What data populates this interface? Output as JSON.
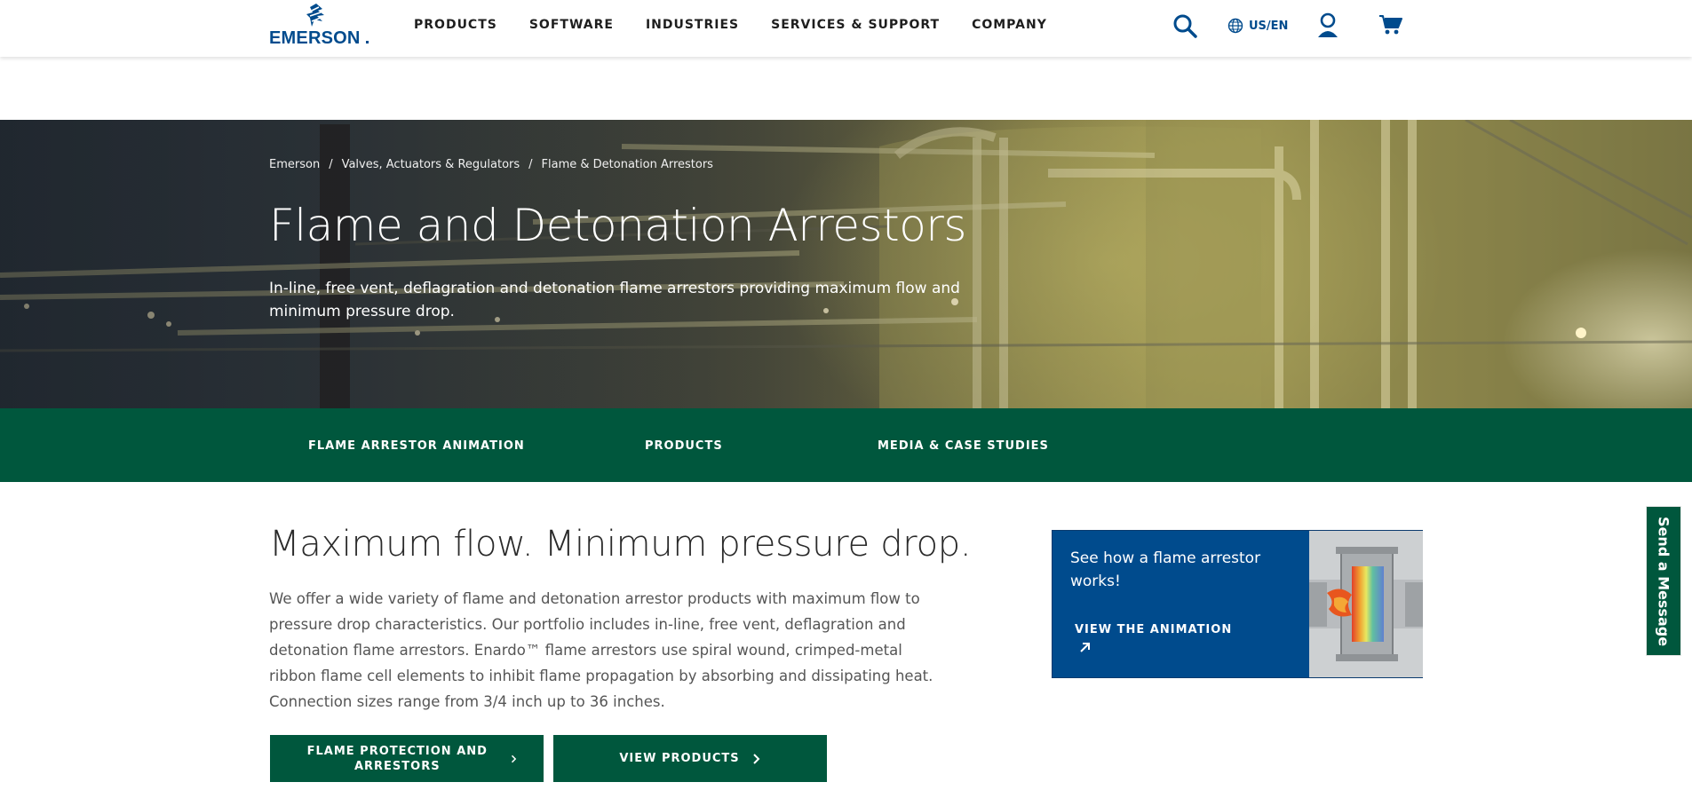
{
  "header": {
    "logo_text": "EMERSON",
    "nav": [
      "PRODUCTS",
      "SOFTWARE",
      "INDUSTRIES",
      "SERVICES & SUPPORT",
      "COMPANY"
    ],
    "locale": "US/EN",
    "icons": [
      "search-icon",
      "globe-icon",
      "user-icon",
      "cart-icon"
    ],
    "accent_color": "#004b8d"
  },
  "hero": {
    "breadcrumb": [
      "Emerson",
      "Valves, Actuators & Regulators",
      "Flame & Detonation Arrestors"
    ],
    "title": "Flame and Detonation Arrestors",
    "subtitle": "In-line, free vent, deflagration and detonation flame arrestors providing maximum flow and minimum pressure drop."
  },
  "subnav": {
    "items": [
      "FLAME ARRESTOR ANIMATION",
      "PRODUCTS",
      "MEDIA & CASE STUDIES"
    ],
    "color": "#00573d"
  },
  "main": {
    "title": "Maximum flow. Minimum pressure drop.",
    "body": "We offer a wide variety of flame and detonation arrestor products with maximum flow to pressure drop characteristics. Our portfolio includes in-line, free vent, deflagration and detonation flame arrestors. Enardo™ flame arrestors use spiral wound, crimped-metal ribbon flame cell elements to inhibit flame propagation by absorbing and dissipating heat. Connection sizes range from 3/4 inch up to 36 inches.",
    "buttons": {
      "flame_protection": "FLAME PROTECTION AND ARRESTORS",
      "view_products": "VIEW PRODUCTS"
    }
  },
  "promo": {
    "text": "See how a flame arrestor works!",
    "link": "VIEW THE ANIMATION"
  },
  "send_message": "Send a Message"
}
